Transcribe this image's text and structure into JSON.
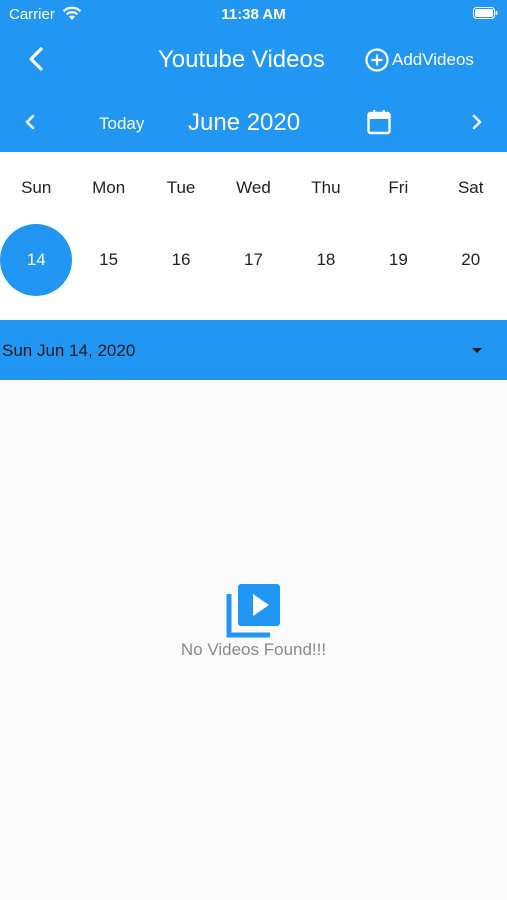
{
  "status_bar": {
    "carrier": "Carrier",
    "time": "11:38 AM"
  },
  "app_bar": {
    "title": "Youtube Videos",
    "add_label": "AddVideos"
  },
  "calendar_bar": {
    "today_label": "Today",
    "month_label": "June 2020"
  },
  "week": {
    "days": [
      "Sun",
      "Mon",
      "Tue",
      "Wed",
      "Thu",
      "Fri",
      "Sat"
    ],
    "dates": [
      "14",
      "15",
      "16",
      "17",
      "18",
      "19",
      "20"
    ],
    "selected_date": "14"
  },
  "date_selector": {
    "label": "Sun Jun 14, 2020"
  },
  "empty_state": {
    "message": "No Videos Found!!!"
  },
  "colors": {
    "accent": "#2196f3",
    "surface": "#ffffff",
    "background": "#fafafa",
    "muted_text": "#8a8a8a"
  },
  "icons": [
    "wifi-icon",
    "battery-icon",
    "back-icon",
    "add-circle-icon",
    "chevron-left-icon",
    "calendar-icon",
    "chevron-right-icon",
    "dropdown-arrow-icon",
    "video-library-icon"
  ]
}
